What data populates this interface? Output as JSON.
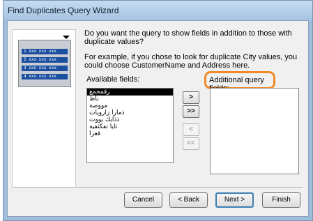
{
  "window": {
    "title": "Find Duplicates Query Wizard"
  },
  "illustration": {
    "rows": [
      "1  xxx xxx xxx",
      "2  xxx xxx xxx",
      "3  xxx xxx xxx",
      "4  xxx xxx xxx"
    ]
  },
  "prompt": {
    "question": "Do you want the query to show fields in addition to those with duplicate values?",
    "example": "For example, if you chose to look for duplicate City values, you could choose CustomerName and Address here."
  },
  "available_fields": {
    "label": "Available fields:",
    "items": [
      "رقمحمع",
      "ناظ",
      "مووصة",
      "ذمارا زارويات",
      "ذذابك يووت",
      "ثايا تفكثفية",
      "قعزا"
    ],
    "selected_index": 0
  },
  "additional_fields": {
    "label": "Additional query fields:",
    "items": []
  },
  "move_buttons": {
    "add_one": ">",
    "add_all": ">>",
    "remove_one": "<",
    "remove_all": "<<"
  },
  "buttons": {
    "cancel": "Cancel",
    "back": "< Back",
    "next": "Next >",
    "finish": "Finish"
  },
  "colors": {
    "highlight_outline": "#f08a28",
    "selection": "#000000"
  }
}
